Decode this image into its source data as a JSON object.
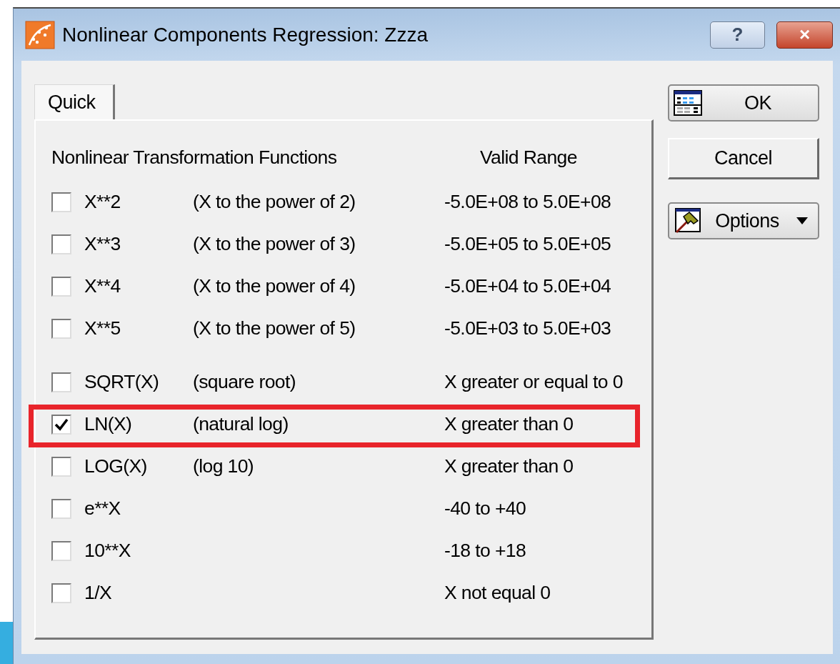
{
  "window": {
    "title": "Nonlinear Components Regression: Zzza",
    "help_button": "?",
    "close_button": "×"
  },
  "tabs": [
    {
      "label": "Quick",
      "selected": true
    }
  ],
  "panel": {
    "heading": "Nonlinear Transformation Functions",
    "range_heading": "Valid Range",
    "groups": [
      {
        "rows": [
          {
            "function": "X**2",
            "description": "(X to the power of 2)",
            "range": "-5.0E+08 to 5.0E+08",
            "checked": false,
            "highlighted": false
          },
          {
            "function": "X**3",
            "description": "(X to the power of 3)",
            "range": "-5.0E+05 to 5.0E+05",
            "checked": false,
            "highlighted": false
          },
          {
            "function": "X**4",
            "description": "(X to the power of 4)",
            "range": "-5.0E+04 to 5.0E+04",
            "checked": false,
            "highlighted": false
          },
          {
            "function": "X**5",
            "description": "(X to the power of 5)",
            "range": "-5.0E+03 to 5.0E+03",
            "checked": false,
            "highlighted": false
          }
        ]
      },
      {
        "rows": [
          {
            "function": "SQRT(X)",
            "description": "(square root)",
            "range": "X greater or equal to 0",
            "checked": false,
            "highlighted": false
          },
          {
            "function": "LN(X)",
            "description": "(natural log)",
            "range": "X greater than 0",
            "checked": true,
            "highlighted": true
          },
          {
            "function": "LOG(X)",
            "description": "(log 10)",
            "range": "X greater than 0",
            "checked": false,
            "highlighted": false
          },
          {
            "function": "e**X",
            "range": "-40 to +40",
            "checked": false,
            "highlighted": false
          },
          {
            "function": "10**X",
            "range": "-18 to +18",
            "checked": false,
            "highlighted": false
          },
          {
            "function": "1/X",
            "range": "X not equal 0",
            "checked": false,
            "highlighted": false
          }
        ]
      }
    ]
  },
  "buttons": [
    {
      "label": "OK"
    },
    {
      "label": "Cancel"
    },
    {
      "label": "Options"
    }
  ]
}
